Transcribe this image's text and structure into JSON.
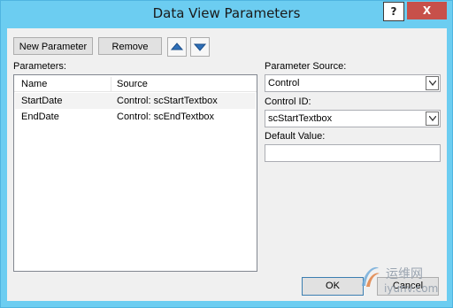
{
  "window": {
    "title": "Data View Parameters",
    "help_label": "?",
    "close_label": "X"
  },
  "toolbar": {
    "new_parameter_label": "New Parameter",
    "remove_label": "Remove",
    "move_up_icon": "up-arrow",
    "move_down_icon": "down-arrow"
  },
  "parameters": {
    "label": "Parameters:",
    "columns": [
      "Name",
      "Source"
    ],
    "rows": [
      {
        "name": "StartDate",
        "source": "Control: scStartTextbox"
      },
      {
        "name": "EndDate",
        "source": "Control: scEndTextbox"
      }
    ]
  },
  "parameter_source": {
    "label": "Parameter Source:",
    "value": "Control"
  },
  "control_id": {
    "label": "Control ID:",
    "value": "scStartTextbox"
  },
  "default_value": {
    "label": "Default Value:",
    "value": ""
  },
  "footer": {
    "ok_label": "OK",
    "cancel_label": "Cancel"
  },
  "watermark": {
    "line1": "运维网",
    "line2": "iyunv.com"
  },
  "colors": {
    "titlebar": "#6ccdf1",
    "close_button": "#c7504a",
    "dialog_bg": "#f0f0f0",
    "arrow_blue": "#2e6fb8"
  }
}
